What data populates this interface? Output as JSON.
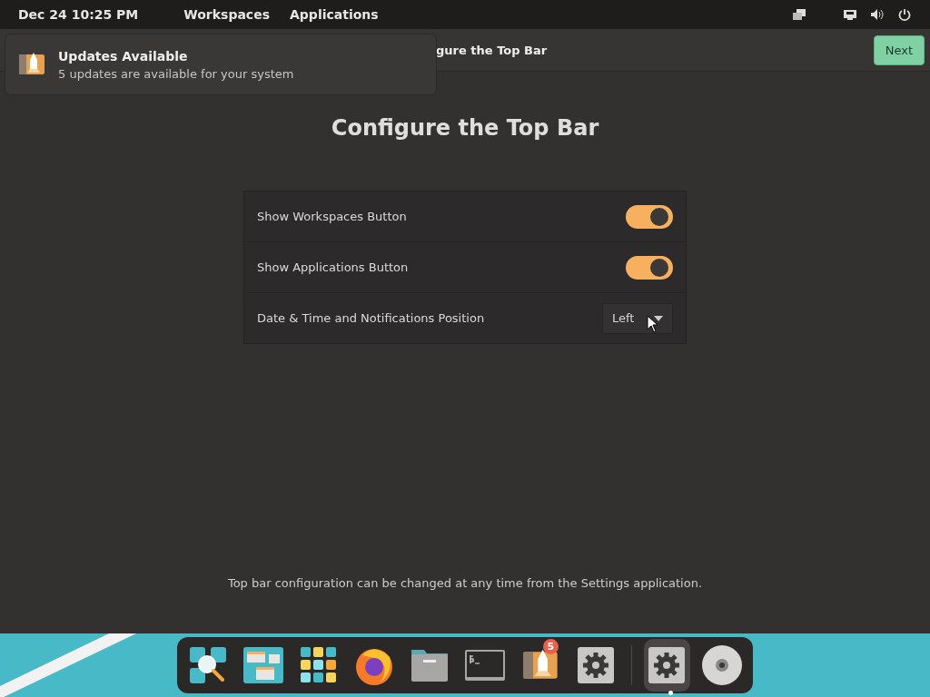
{
  "top_bar": {
    "clock": "Dec 24  10:25 PM",
    "menus": [
      "Workspaces",
      "Applications"
    ]
  },
  "header": {
    "title": "gure the Top Bar",
    "next_button": "Next"
  },
  "notification": {
    "title": "Updates Available",
    "body": "5 updates are available for your system"
  },
  "page": {
    "heading": "Configure the Top Bar",
    "settings": [
      {
        "kind": "switch",
        "label": "Show Workspaces Button",
        "on": true
      },
      {
        "kind": "switch",
        "label": "Show Applications Button",
        "on": true
      },
      {
        "kind": "dropdown",
        "label": "Date & Time and Notifications Position",
        "value": "Left"
      }
    ],
    "footnote": "Top bar configuration can be changed at any time from the Settings application."
  },
  "dock": {
    "items": [
      {
        "kind": "search",
        "selected": false
      },
      {
        "kind": "workspaces",
        "selected": false
      },
      {
        "kind": "apps",
        "selected": false
      },
      {
        "kind": "browser",
        "selected": false
      },
      {
        "kind": "files",
        "selected": false
      },
      {
        "kind": "terminal",
        "selected": false
      },
      {
        "kind": "shop",
        "selected": false,
        "badge": "5"
      },
      {
        "kind": "settings",
        "selected": false
      },
      {
        "kind": "separator"
      },
      {
        "kind": "settings",
        "selected": true
      },
      {
        "kind": "disc",
        "selected": false
      }
    ]
  }
}
